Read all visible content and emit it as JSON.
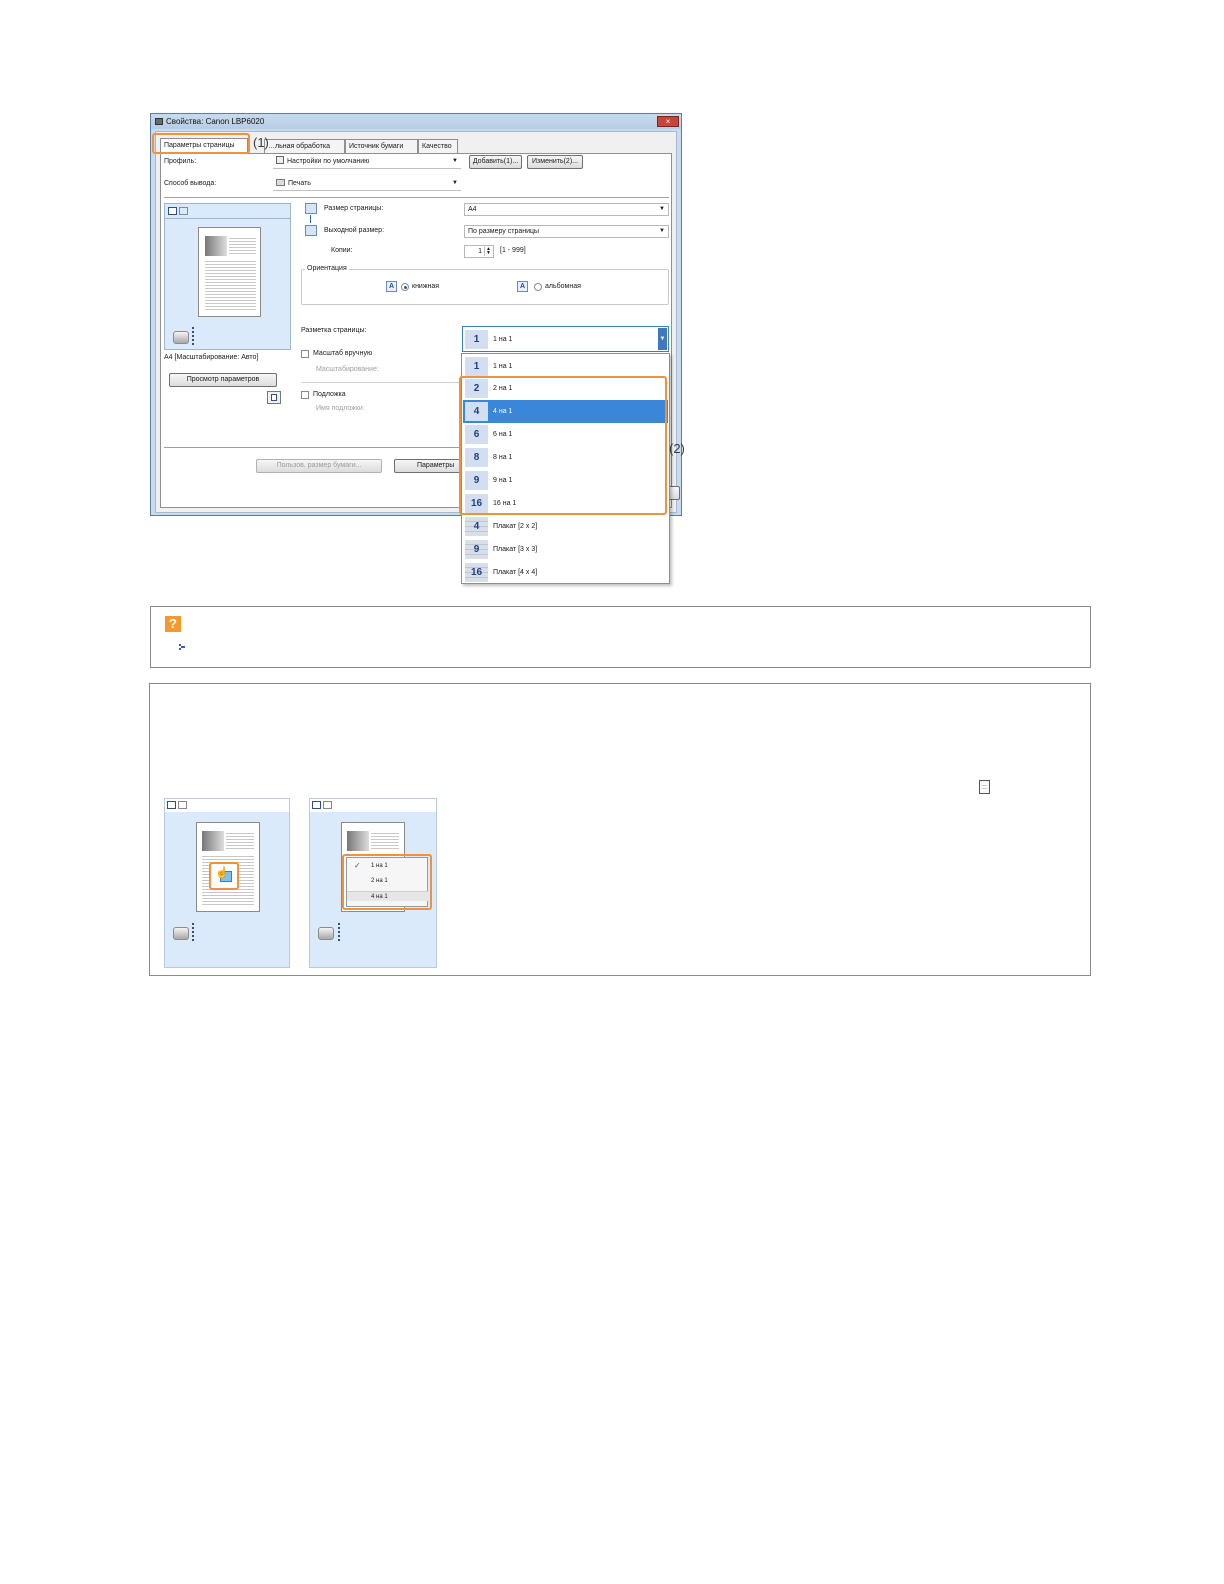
{
  "dialog": {
    "title": "Свойства: Canon LBP6020",
    "close_label": "×",
    "tabs": [
      "Параметры страницы",
      "…льная обработка",
      "Источник бумаги",
      "Качество"
    ],
    "profile_label": "Профиль:",
    "profile_value": "Настройки по умолчанию",
    "add_button": "Добавить(1)...",
    "edit_button": "Изменить(2)...",
    "output_label": "Способ вывода:",
    "output_value": "Печать",
    "page_size_label": "Размер страницы:",
    "page_size_value": "A4",
    "output_size_label": "Выходной размер:",
    "output_size_value": "По размеру страницы",
    "copies_label": "Копии:",
    "copies_value": "1",
    "copies_range": "[1 - 999]",
    "orientation_label": "Ориентация",
    "portrait_label": "книжная",
    "landscape_label": "альбомная",
    "layout_label": "Разметка страницы:",
    "layout_value_num": "1",
    "layout_value": "1 на 1",
    "manual_scale_label": "Масштаб вручную",
    "scaling_label": "Масштабирование:",
    "watermark_label": "Подложка",
    "watermark_name_label": "Имя подложки:",
    "preview_caption": "A4 [Масштабирование: Авто]",
    "view_settings_button": "Просмотр параметров",
    "custom_paper_button": "Пользов. размер бумаги...",
    "params_button": "Параметры"
  },
  "dropdown": {
    "items": [
      {
        "num": "1",
        "label": "1 на 1"
      },
      {
        "num": "2",
        "label": "2 на 1"
      },
      {
        "num": "4",
        "label": "4 на 1"
      },
      {
        "num": "6",
        "label": "6 на 1"
      },
      {
        "num": "8",
        "label": "8 на 1"
      },
      {
        "num": "9",
        "label": "9 на 1"
      },
      {
        "num": "16",
        "label": "16 на 1"
      },
      {
        "num": "4",
        "label": "Плакат [2 x 2]"
      },
      {
        "num": "9",
        "label": "Плакат [3 x 3]"
      },
      {
        "num": "16",
        "label": "Плакат [4 x 4]"
      }
    ],
    "selected_index": 2
  },
  "callouts": {
    "one": "(1)",
    "two": "(2)"
  },
  "hint": {
    "icon": "?"
  },
  "mini_menu": {
    "check": "✓",
    "items": [
      "1 на 1",
      "2 на 1",
      "4 на 1"
    ]
  },
  "colors": {
    "accent": "#f0913d",
    "selection": "#3a86d8",
    "preview_bg": "#dbeafa"
  }
}
